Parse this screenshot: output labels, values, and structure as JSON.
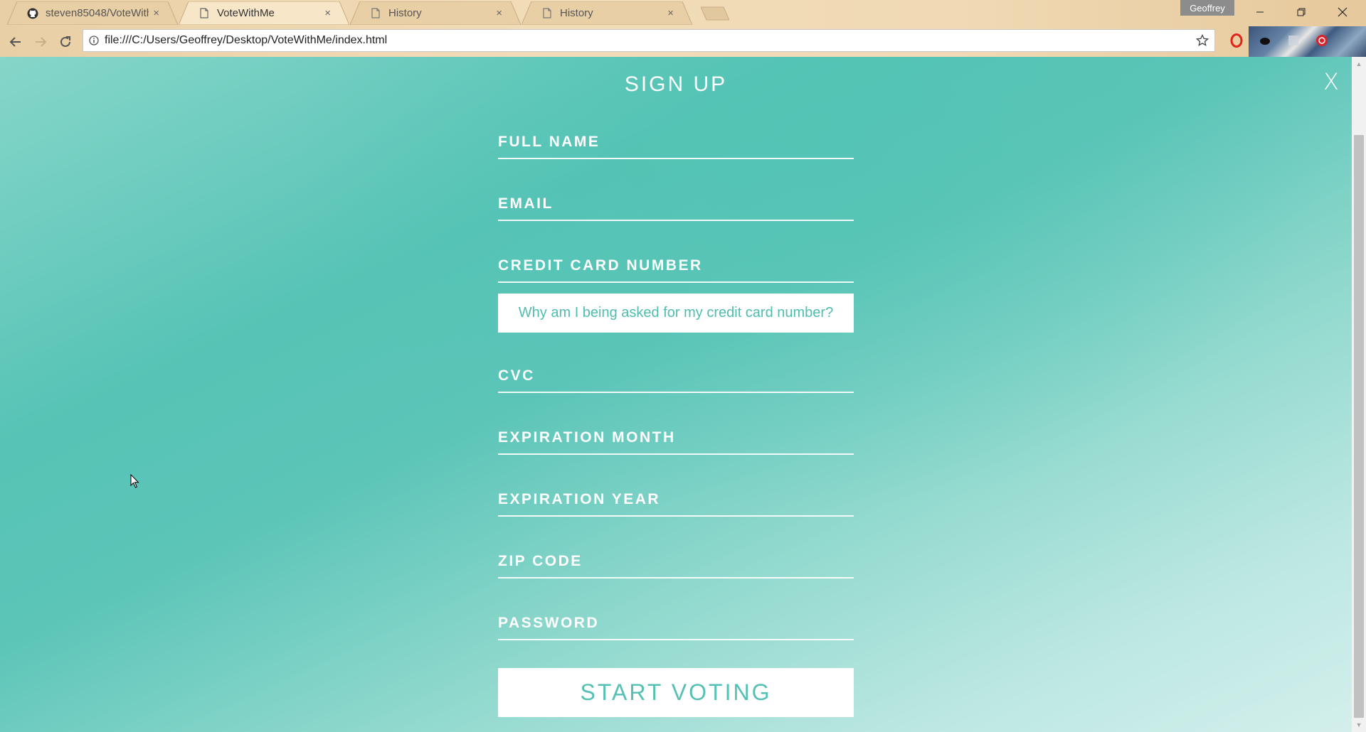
{
  "browser": {
    "tabs": [
      {
        "title": "steven85048/VoteWithM",
        "favicon": "github-icon",
        "active": false
      },
      {
        "title": "VoteWithMe",
        "favicon": "page-icon",
        "active": true
      },
      {
        "title": "History",
        "favicon": "page-icon",
        "active": false
      },
      {
        "title": "History",
        "favicon": "page-icon",
        "active": false
      }
    ],
    "close_glyph": "×",
    "profile_name": "Geoffrey",
    "url": "file:///C:/Users/Geoffrey/Desktop/VoteWithMe/index.html"
  },
  "page": {
    "close_label": "X",
    "title": "SIGN UP",
    "fields": {
      "full_name": "FULL NAME",
      "email": "EMAIL",
      "card_number": "CREDIT CARD NUMBER",
      "cvc": "CVC",
      "exp_month": "EXPIRATION MONTH",
      "exp_year": "EXPIRATION YEAR",
      "zip": "ZIP CODE",
      "password": "PASSWORD"
    },
    "why_label": "Why am I being asked for my credit card number?",
    "submit_label": "START VOTING"
  },
  "colors": {
    "accent": "#4fbdb0",
    "background_teal": "#56c3b6",
    "tab_strip": "#f0d9b4"
  }
}
